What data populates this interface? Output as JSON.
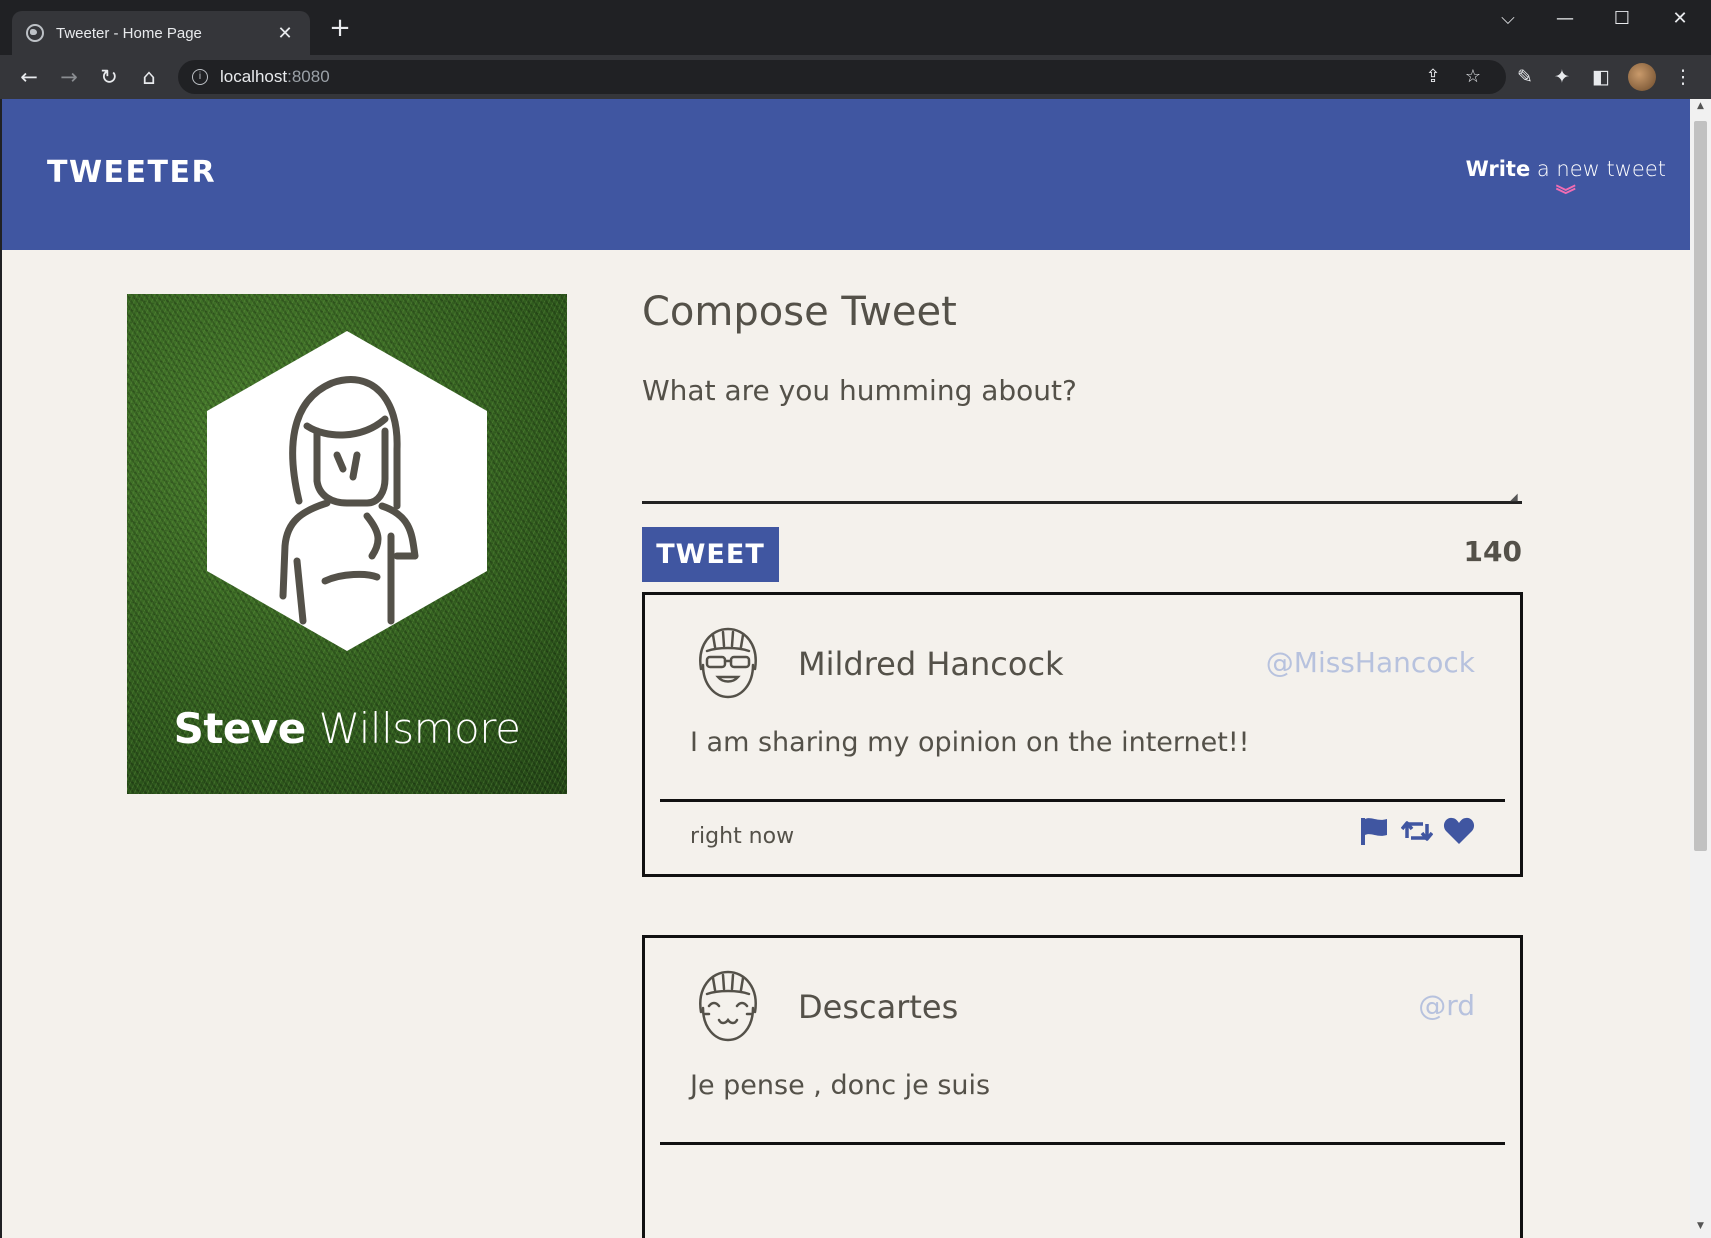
{
  "browser": {
    "tab_title": "Tweeter - Home Page",
    "tab_close": "✕",
    "new_tab": "+",
    "url_host": "localhost",
    "url_port": ":8080",
    "window_controls": {
      "tabsearch": "⌵",
      "minimize": "—",
      "maximize": "☐",
      "close": "✕"
    },
    "nav": {
      "back": "←",
      "forward": "→",
      "reload": "↻",
      "home": "⌂"
    }
  },
  "nav": {
    "brand": "TWEETER",
    "write_bold": "Write",
    "write_rest": " a new tweet",
    "chevron": "︾"
  },
  "profile": {
    "first_name": "Steve",
    "last_name": "Willsmore"
  },
  "compose": {
    "title": "Compose Tweet",
    "label": "What are you humming about?",
    "placeholder": "",
    "button_label": "TWEET",
    "counter": "140"
  },
  "tweets": [
    {
      "name": "Mildred Hancock",
      "handle": "@MissHancock",
      "content": "I am sharing my opinion on the internet!!",
      "time": "right now"
    },
    {
      "name": "Descartes",
      "handle": "@rd",
      "content": "Je pense , donc je suis",
      "time": ""
    }
  ],
  "colors": {
    "nav_bg": "#4056a1",
    "accent_pink": "#f16cb3",
    "page_bg": "#f4f1ec",
    "text": "#545149",
    "handle": "#b7c2de"
  }
}
